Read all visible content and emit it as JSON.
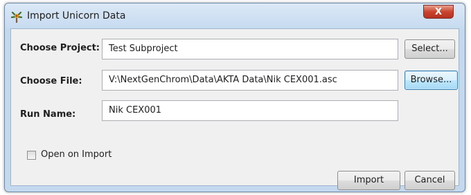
{
  "window": {
    "title": "Import Unicorn Data",
    "close_symbol": "X",
    "app_icon": "unicorn-app-icon"
  },
  "form": {
    "project_label": "Choose Project:",
    "project_value": "Test Subproject",
    "select_button": "Select...",
    "file_label": "Choose File:",
    "file_value": "V:\\NextGenChrom\\Data\\AKTA Data\\Nik CEX001.asc",
    "browse_button": "Browse...",
    "run_label": "Run Name:",
    "run_value": "Nik CEX001",
    "open_on_import_label": "Open on Import",
    "open_on_import_checked": false
  },
  "actions": {
    "import_button": "Import",
    "cancel_button": "Cancel"
  },
  "colors": {
    "titlebar": "#c7dbf0",
    "close_button": "#c9442e",
    "focused_button": "#bee6fd",
    "client_background": "#f0f0f0"
  }
}
